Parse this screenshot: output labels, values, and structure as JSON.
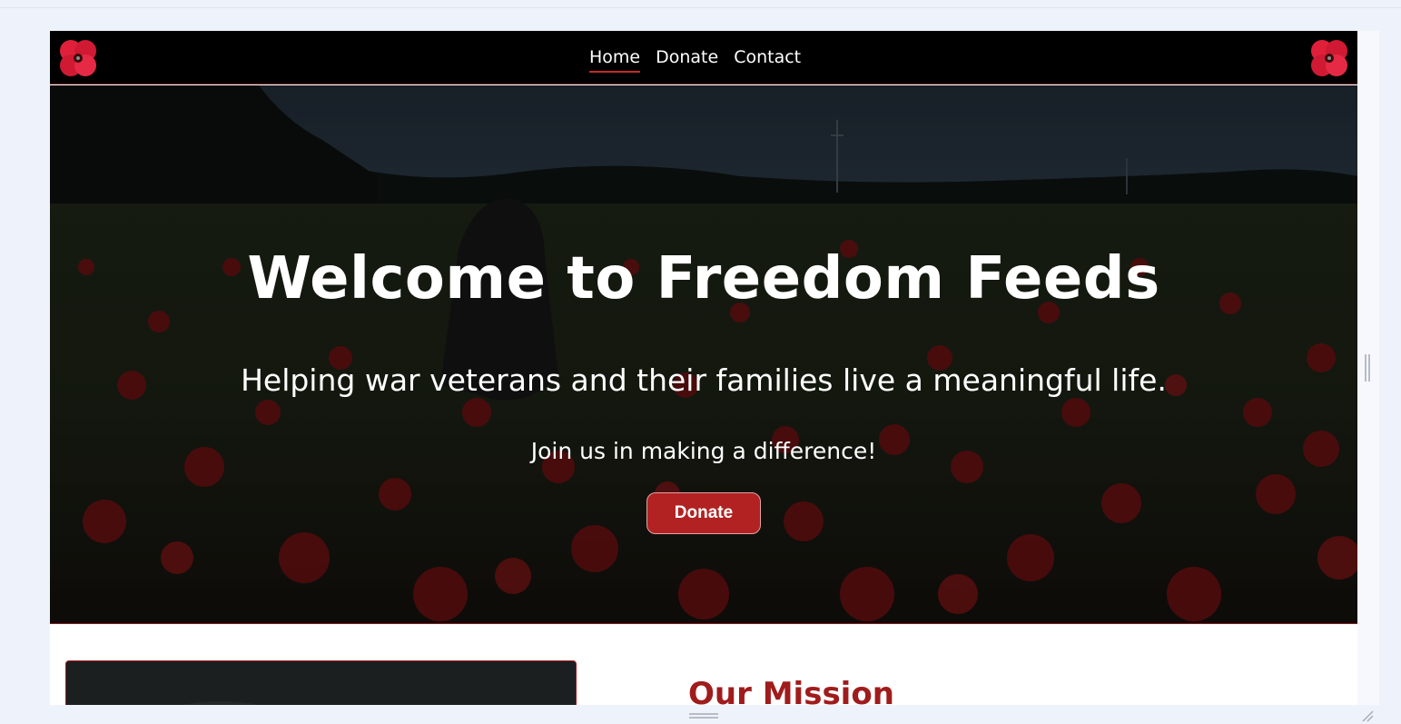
{
  "nav": {
    "logo_icon": "poppy-icon",
    "links": [
      {
        "label": "Home",
        "active": true
      },
      {
        "label": "Donate",
        "active": false
      },
      {
        "label": "Contact",
        "active": false
      }
    ]
  },
  "hero": {
    "title": "Welcome to Freedom Feeds",
    "subtitle": "Helping war veterans and their families live a meaningful life.",
    "call_to_action": "Join us in making a difference!",
    "donate_button": "Donate"
  },
  "mission": {
    "title": "Our Mission"
  },
  "colors": {
    "accent": "#b22222",
    "nav_background": "#000000",
    "mission_title": "#a01c1c"
  }
}
